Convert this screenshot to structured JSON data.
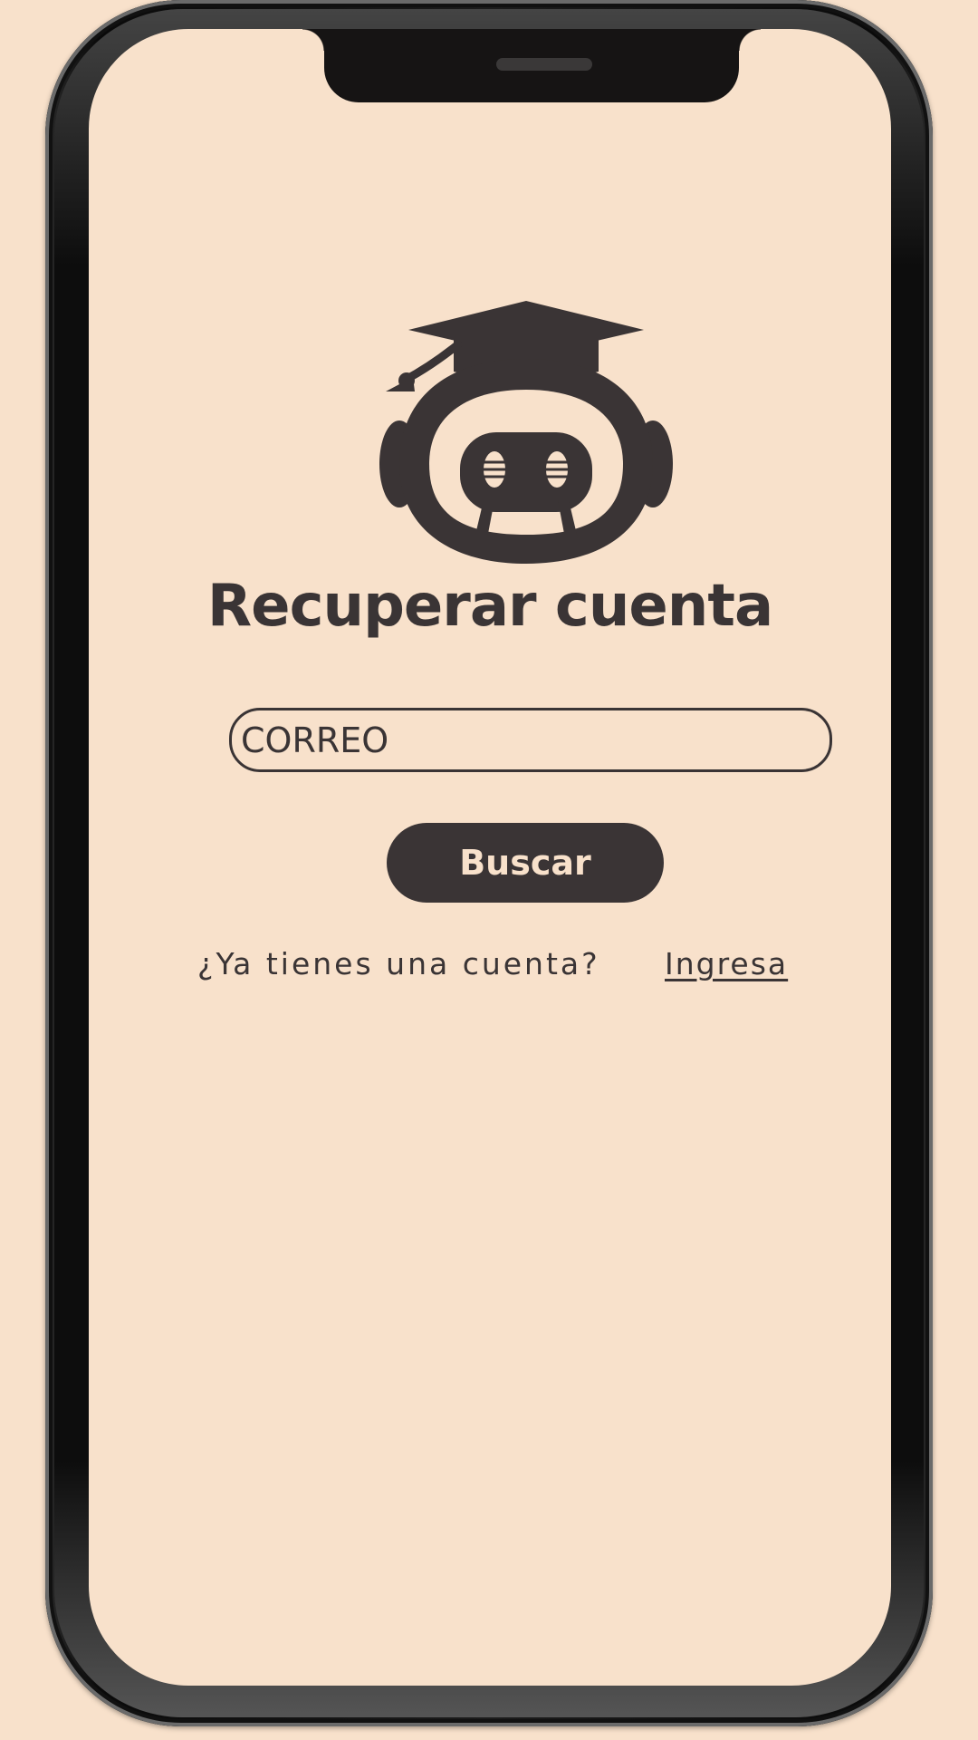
{
  "screen": {
    "title": "Recuperar cuenta"
  },
  "form": {
    "email_placeholder": "CORREO",
    "email_value": "",
    "submit_label": "Buscar"
  },
  "footer": {
    "prompt_text": "¿Ya tienes una cuenta?",
    "login_link_label": "Ingresa"
  },
  "logo": {
    "icon": "graduation-robot-icon"
  },
  "colors": {
    "background": "#f8e1cb",
    "primary": "#3a3435",
    "button_text": "#f8e1cb",
    "device_frame": "#111111"
  }
}
